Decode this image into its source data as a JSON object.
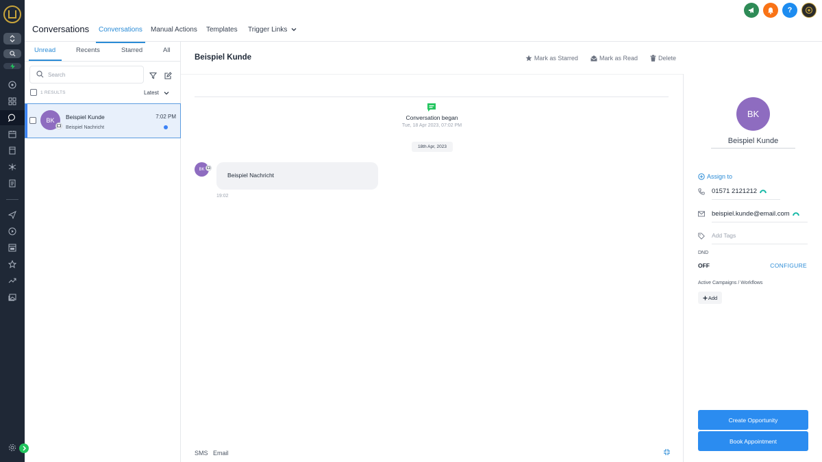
{
  "colors": {
    "accent": "#2a8bd6",
    "avatar": "#8e6cc0",
    "primary_button": "#2b8cf0",
    "rail": "#1f2836"
  },
  "header": {
    "title": "Conversations",
    "tabs": [
      {
        "label": "Conversations",
        "active": true
      },
      {
        "label": "Manual Actions"
      },
      {
        "label": "Templates"
      },
      {
        "label": "Trigger Links"
      }
    ],
    "top_icons": [
      "megaphone-icon",
      "bell-icon",
      "help-icon",
      "account-avatar"
    ]
  },
  "list": {
    "tabs": [
      {
        "label": "Unread",
        "active": true
      },
      {
        "label": "Recents"
      },
      {
        "label": "Starred"
      },
      {
        "label": "All"
      }
    ],
    "search_placeholder": "Search",
    "results": "1 RESULTS",
    "sort": "Latest",
    "items": [
      {
        "initials": "BK",
        "name": "Beispiel Kunde",
        "preview": "Beispiel Nachricht",
        "time": "7:02 PM",
        "unread": true
      }
    ]
  },
  "chat": {
    "title": "Beispiel Kunde",
    "actions": [
      {
        "label": "Mark as Starred",
        "icon": "star-icon"
      },
      {
        "label": "Mark as Read",
        "icon": "envelope-open-icon"
      },
      {
        "label": "Delete",
        "icon": "trash-icon"
      }
    ],
    "began_title": "Conversation began",
    "began_sub": "Tue, 18 Apr 2023, 07:02 PM",
    "date_divider": "18th Apr, 2023",
    "messages": [
      {
        "initials": "BK",
        "text": "Beispiel Nachricht",
        "time": "19:02"
      }
    ],
    "composer_tabs": [
      "SMS",
      "Email"
    ]
  },
  "contact": {
    "initials": "BK",
    "name": "Beispiel Kunde",
    "assign_label": "Assign to",
    "phone": "01571 2121212",
    "email": "beispiel.kunde@email.com",
    "tags_placeholder": "Add Tags",
    "dnd_label": "DND",
    "dnd_value": "OFF",
    "configure_label": "CONFIGURE",
    "campaigns_label": "Active Campaigns / Workflows",
    "add_label": "Add",
    "create_opportunity": "Create Opportunity",
    "book_appointment": "Book Appointment"
  }
}
